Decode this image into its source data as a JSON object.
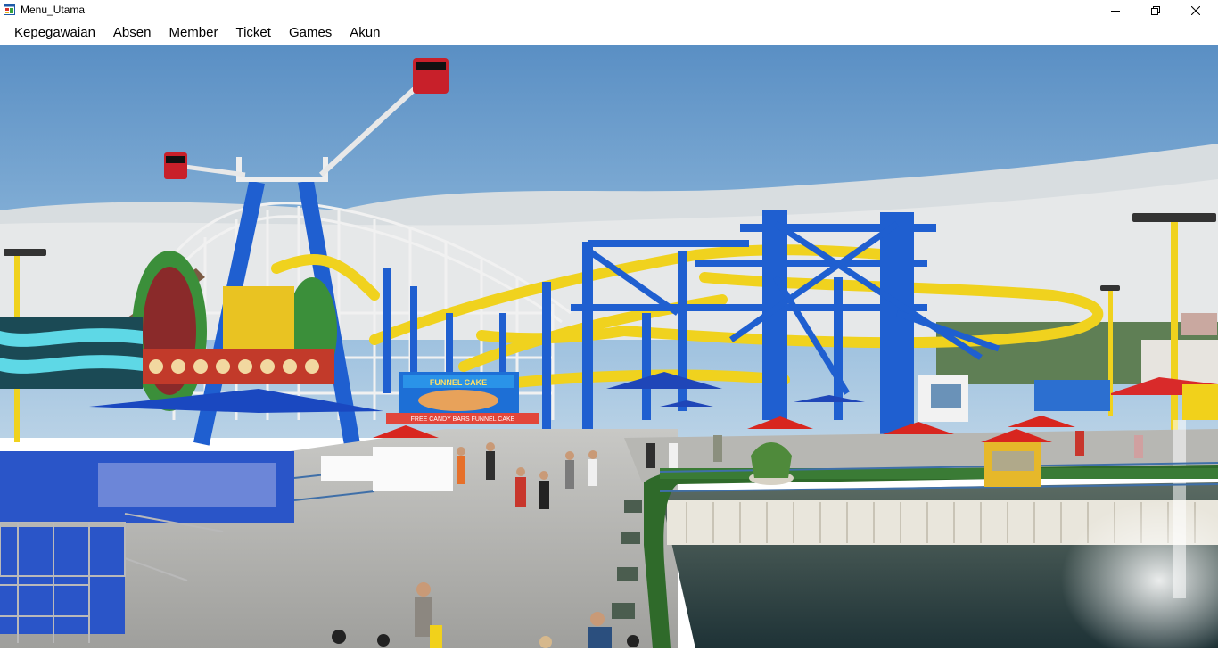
{
  "window": {
    "title": "Menu_Utama",
    "icon": "windows-form-icon",
    "controls": [
      "minimize-icon",
      "restore-icon",
      "close-icon"
    ]
  },
  "menu": {
    "items": [
      {
        "label": "Kepegawaian"
      },
      {
        "label": "Absen"
      },
      {
        "label": "Member"
      },
      {
        "label": "Ticket"
      },
      {
        "label": "Games"
      },
      {
        "label": "Akun"
      }
    ]
  },
  "background": {
    "image_subject": "amusement-park-photo",
    "signs": {
      "stand_banner": "FUNNEL CAKE",
      "stand_sub": "FREE CANDY BARS FUNNEL CAKE"
    },
    "colors": {
      "sky": "#6f9fc9",
      "coaster_track": "#f0d21e",
      "coaster_support": "#1f5fd0",
      "water": "#2f4a4e",
      "walkway": "#b3b3b1"
    }
  }
}
